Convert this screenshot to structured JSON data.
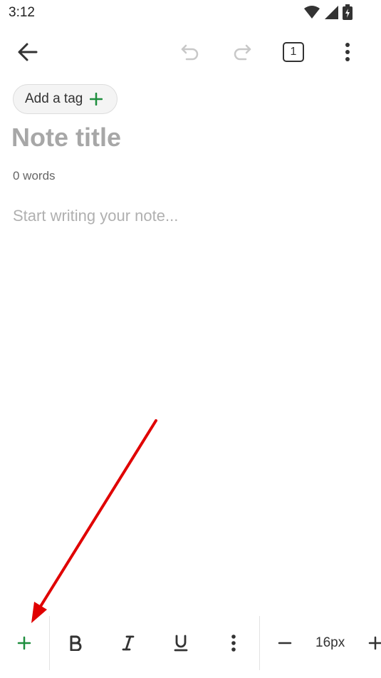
{
  "status_bar": {
    "time": "3:12",
    "icons": [
      "wifi-icon",
      "cell-signal-icon",
      "battery-charging-icon"
    ]
  },
  "toolbar": {
    "back_icon": "arrow-left-icon",
    "undo_icon": "undo-icon",
    "redo_icon": "redo-icon",
    "tab_count": "1",
    "more_icon": "more-vertical-icon"
  },
  "tag": {
    "label": "Add a tag",
    "icon": "plus-icon"
  },
  "note": {
    "title_placeholder": "Note title",
    "word_count": "0 words",
    "body_placeholder": "Start writing your note..."
  },
  "format_bar": {
    "add_icon": "plus-icon",
    "bold_icon": "bold-icon",
    "italic_icon": "italic-icon",
    "underline_icon": "underline-icon",
    "more_icon": "more-vertical-icon",
    "decrease_icon": "minus-icon",
    "font_size": "16px",
    "increase_icon": "plus-icon"
  },
  "colors": {
    "accent_green": "#1e8e3e",
    "annotation_red": "#e00000",
    "disabled_icon": "#c8c8c8",
    "placeholder": "#a7a7a7"
  }
}
